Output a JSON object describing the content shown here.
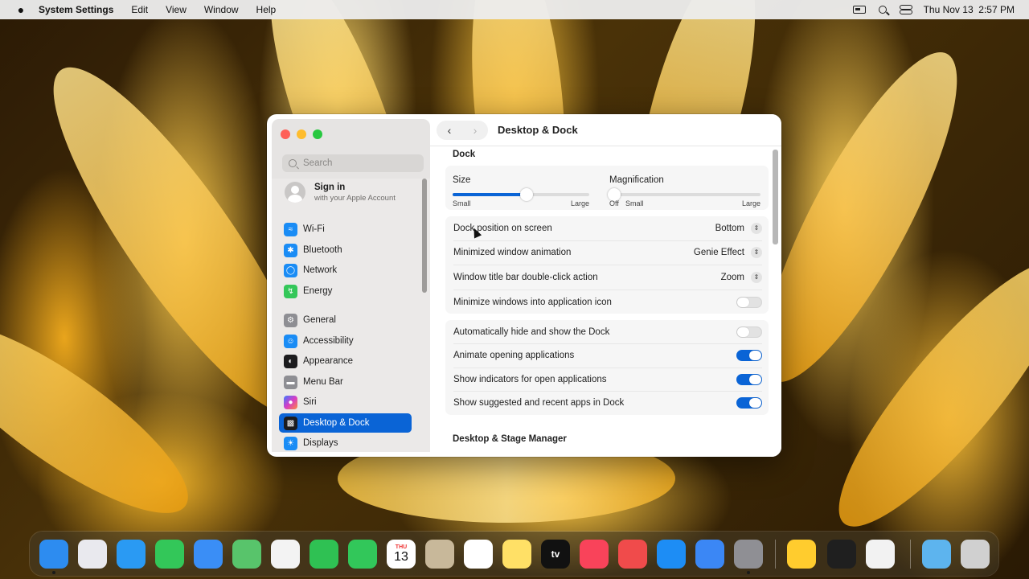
{
  "menubar": {
    "apple_icon": "apple-logo-icon",
    "app_name": "System Settings",
    "menus": [
      "Edit",
      "View",
      "Window",
      "Help"
    ],
    "date": "Thu Nov 13",
    "time": "2:57 PM"
  },
  "window": {
    "title": "Desktop & Dock",
    "sidebar": {
      "search_placeholder": "Search",
      "account": {
        "title": "Sign in",
        "subtitle": "with your Apple Account"
      },
      "items": [
        {
          "label": "Wi-Fi",
          "icon": "wifi-icon",
          "color": "#1a8cf5"
        },
        {
          "label": "Bluetooth",
          "icon": "bluetooth-icon",
          "color": "#1a8cf5"
        },
        {
          "label": "Network",
          "icon": "network-globe-icon",
          "color": "#1a8cf5"
        },
        {
          "label": "Energy",
          "icon": "energy-bolt-icon",
          "color": "#34c759"
        },
        {
          "label": "General",
          "icon": "gear-icon",
          "color": "#8e8e93"
        },
        {
          "label": "Accessibility",
          "icon": "accessibility-icon",
          "color": "#1a8cf5"
        },
        {
          "label": "Appearance",
          "icon": "appearance-icon",
          "color": "#1c1c1e"
        },
        {
          "label": "Menu Bar",
          "icon": "menu-bar-icon",
          "color": "#8e8e93"
        },
        {
          "label": "Siri",
          "icon": "siri-icon",
          "color": "#c042d8"
        },
        {
          "label": "Desktop & Dock",
          "icon": "dock-icon",
          "color": "#1c1c1e"
        },
        {
          "label": "Displays",
          "icon": "displays-icon",
          "color": "#1a8cf5"
        }
      ],
      "active_item": "Desktop & Dock"
    },
    "content": {
      "dock_section_title": "Dock",
      "size_slider": {
        "label": "Size",
        "min_label": "Small",
        "max_label": "Large",
        "value": 0.54
      },
      "magnification_slider": {
        "label": "Magnification",
        "off_label": "Off",
        "min_label": "Small",
        "max_label": "Large",
        "value": 0.0
      },
      "settings_group_1": [
        {
          "label": "Dock position on screen",
          "value": "Bottom",
          "control": "popup"
        },
        {
          "label": "Minimized window animation",
          "value": "Genie Effect",
          "control": "popup"
        },
        {
          "label": "Window title bar double-click action",
          "value": "Zoom",
          "control": "popup"
        },
        {
          "label": "Minimize windows into application icon",
          "control": "toggle",
          "on": false
        }
      ],
      "settings_group_2": [
        {
          "label": "Automatically hide and show the Dock",
          "control": "toggle",
          "on": false
        },
        {
          "label": "Animate opening applications",
          "control": "toggle",
          "on": true
        },
        {
          "label": "Show indicators for open applications",
          "control": "toggle",
          "on": true
        },
        {
          "label": "Show suggested and recent apps in Dock",
          "control": "toggle",
          "on": true
        }
      ],
      "stage_manager_section_title": "Desktop & Stage Manager"
    }
  },
  "dock": {
    "calendar_month": "THU",
    "calendar_day": "13",
    "appletv_label": "tv",
    "apps": [
      {
        "name": "finder-icon",
        "color": "#2d8cf0",
        "running": true
      },
      {
        "name": "launchpad-icon",
        "color": "#e9e9ee",
        "running": false
      },
      {
        "name": "safari-icon",
        "color": "#2a9af3",
        "running": false
      },
      {
        "name": "messages-icon",
        "color": "#33c759",
        "running": false
      },
      {
        "name": "mail-icon",
        "color": "#3a8ef6",
        "running": false
      },
      {
        "name": "maps-icon",
        "color": "#58c46b",
        "running": false
      },
      {
        "name": "photos-icon",
        "color": "#f3f3f3",
        "running": false
      },
      {
        "name": "facetime-icon",
        "color": "#2fc153",
        "running": false
      },
      {
        "name": "phone-icon",
        "color": "#32c75a",
        "running": false
      },
      {
        "name": "calendar-icon",
        "color": "#ffffff",
        "running": false
      },
      {
        "name": "contacts-icon",
        "color": "#c8b89a",
        "running": false
      },
      {
        "name": "reminders-icon",
        "color": "#ffffff",
        "running": false
      },
      {
        "name": "notes-icon",
        "color": "#ffe066",
        "running": false
      },
      {
        "name": "apple-tv-icon",
        "color": "#111111",
        "running": false
      },
      {
        "name": "music-icon",
        "color": "#f9435a",
        "running": false
      },
      {
        "name": "rocketsim-icon",
        "color": "#f04b4b",
        "running": false
      },
      {
        "name": "app-store-icon",
        "color": "#1d8df5",
        "running": false
      },
      {
        "name": "iphone-mirroring-icon",
        "color": "#3b87f5",
        "running": false
      },
      {
        "name": "system-settings-icon",
        "color": "#8f8f94",
        "running": true
      },
      {
        "name": "tips-icon",
        "color": "#ffcc2e",
        "running": false
      },
      {
        "name": "keynote-numbers-icon",
        "color": "#1f1f1f",
        "running": false
      },
      {
        "name": "preview-icon",
        "color": "#f2f2f2",
        "running": false
      },
      {
        "name": "downloads-folder-icon",
        "color": "#5db4ee",
        "running": false
      },
      {
        "name": "trash-icon",
        "color": "#d0d0d0",
        "running": false
      }
    ]
  }
}
